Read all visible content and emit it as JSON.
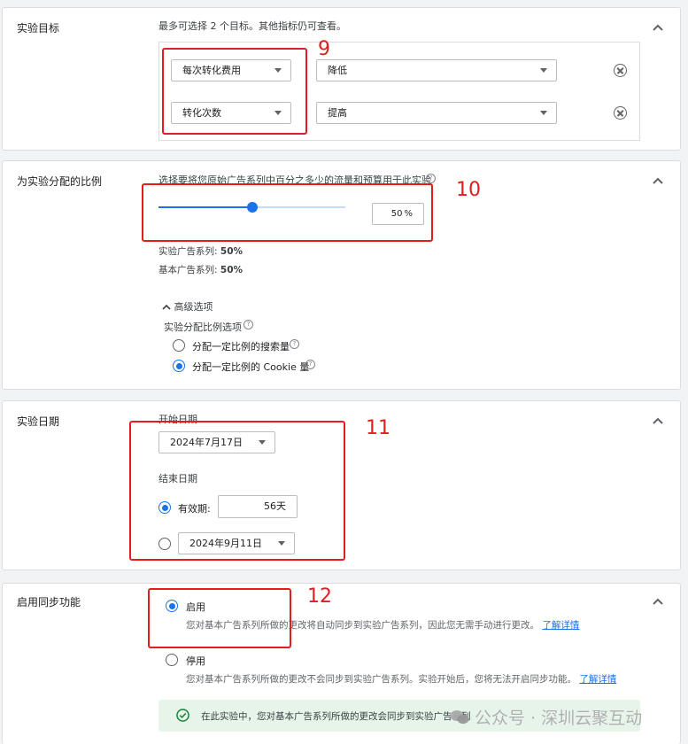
{
  "goals": {
    "title": "实验目标",
    "hint": "最多可选择 2 个目标。其他指标仍可查看。",
    "rows": [
      {
        "metric": "每次转化费用",
        "direction": "降低"
      },
      {
        "metric": "转化次数",
        "direction": "提高"
      }
    ],
    "annotation": "9"
  },
  "split": {
    "title": "为实验分配的比例",
    "description": "选择要将您原始广告系列中百分之多少的流量和预算用于此实验",
    "slider_value_percent": 50,
    "input_value": "50",
    "unit": "%",
    "experiment_label": "实验广告系列:",
    "experiment_value": "50%",
    "base_label": "基本广告系列:",
    "base_value": "50%",
    "advanced_toggle": "高级选项",
    "split_options_label": "实验分配比例选项",
    "option_search": "分配一定比例的搜索量",
    "option_cookie": "分配一定比例的 Cookie 量",
    "annotation": "10"
  },
  "dates": {
    "title": "实验日期",
    "start_label": "开始日期",
    "start_value": "2024年7月17日",
    "end_label": "结束日期",
    "duration_label": "有效期:",
    "duration_value": "56天",
    "end_date_value": "2024年9月11日",
    "annotation": "11"
  },
  "sync": {
    "title": "启用同步功能",
    "on_label": "启用",
    "on_desc": "您对基本广告系列所做的更改将自动同步到实验广告系列，因此您无需手动进行更改。",
    "off_label": "停用",
    "off_desc": "您对基本广告系列所做的更改不会同步到实验广告系列。实验开始后，您将无法开启同步功能。",
    "learn_more": "了解详情",
    "info": "在此实验中，您对基本广告系列所做的更改会同步到实验广告系列",
    "annotation": "12"
  },
  "watermark": "公众号 · 深圳云聚互动",
  "colors": {
    "accent": "#1a73e8",
    "annotation": "#e21d1d",
    "success": "#188038"
  }
}
